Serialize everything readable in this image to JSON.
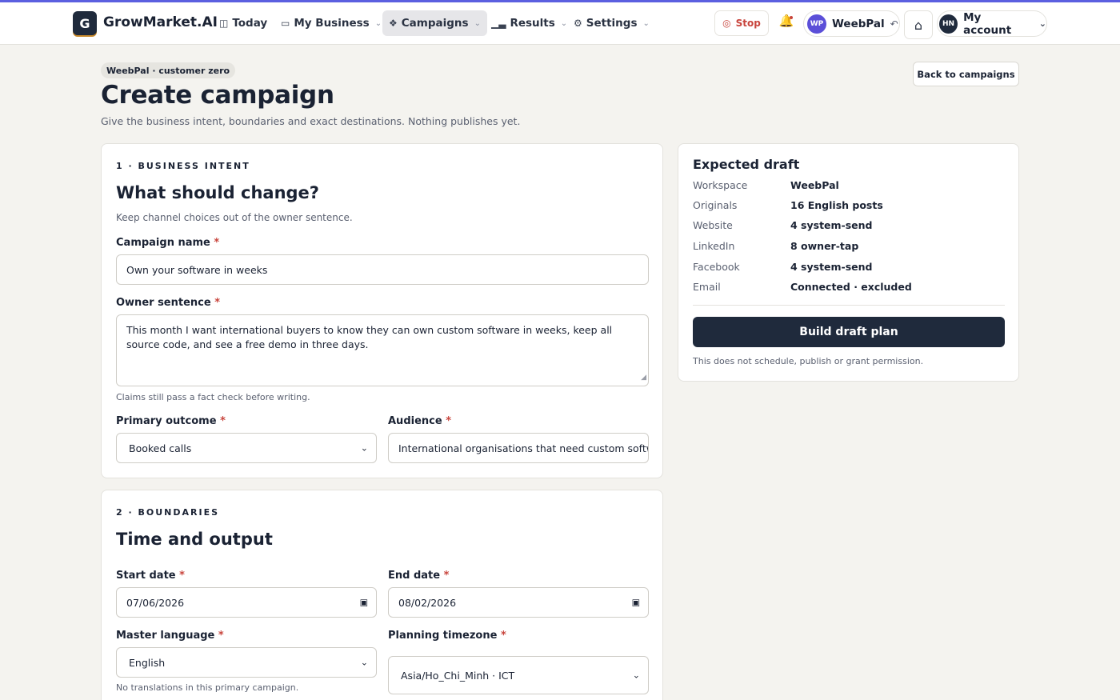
{
  "app": {
    "logo_letter": "G",
    "brand": "GrowMarket.AI"
  },
  "nav": {
    "items": [
      {
        "label": "Today",
        "icon": "inbox-icon",
        "chevron": false
      },
      {
        "label": "My Business",
        "icon": "book-icon",
        "chevron": true
      },
      {
        "label": "Campaigns",
        "icon": "layers-icon",
        "chevron": true,
        "active": true
      },
      {
        "label": "Results",
        "icon": "bar-chart-icon",
        "chevron": true
      },
      {
        "label": "Settings",
        "icon": "gear-icon",
        "chevron": true
      }
    ]
  },
  "header": {
    "stop_label": "Stop",
    "workspace_initials": "WP",
    "workspace_name": "WeebPal",
    "account_initials": "HN",
    "account_label": "My account"
  },
  "page": {
    "badge": "WeebPal · customer zero",
    "title": "Create campaign",
    "subtitle": "Give the business intent, boundaries and exact destinations. Nothing publishes yet.",
    "back_label": "Back to campaigns"
  },
  "section1": {
    "step": "1 · BUSINESS INTENT",
    "title": "What should change?",
    "hint": "Keep channel choices out of the owner sentence.",
    "campaign_name_label": "Campaign name",
    "campaign_name_value": "Own your software in weeks",
    "owner_sentence_label": "Owner sentence",
    "owner_sentence_value": "This month I want international buyers to know they can own custom software in weeks, keep all source code, and see a free demo in three days.",
    "owner_sentence_hint": "Claims still pass a fact check before writing.",
    "primary_outcome_label": "Primary outcome",
    "primary_outcome_value": "Booked calls",
    "audience_label": "Audience",
    "audience_value": "International organisations that need custom softw"
  },
  "section2": {
    "step": "2 · BOUNDARIES",
    "title": "Time and output",
    "start_date_label": "Start date",
    "start_date_value": "07/06/2026",
    "end_date_label": "End date",
    "end_date_value": "08/02/2026",
    "master_language_label": "Master language",
    "master_language_value": "English",
    "master_language_hint": "No translations in this primary campaign.",
    "timezone_label": "Planning timezone",
    "timezone_value": "Asia/Ho_Chi_Minh · ICT"
  },
  "required_mark": "*",
  "draft": {
    "title": "Expected draft",
    "rows": [
      {
        "key": "Workspace",
        "value": "WeebPal"
      },
      {
        "key": "Originals",
        "value": "16 English posts"
      },
      {
        "key": "Website",
        "value": "4 system-send"
      },
      {
        "key": "LinkedIn",
        "value": "8 owner-tap"
      },
      {
        "key": "Facebook",
        "value": "4 system-send"
      },
      {
        "key": "Email",
        "value": "Connected · excluded"
      }
    ],
    "build_label": "Build draft plan",
    "note": "This does not schedule, publish or grant permission."
  },
  "colors": {
    "accent": "#5b5fe0",
    "primary_dark": "#1f2a3c",
    "required": "#c8443c",
    "background": "#f4f3ef"
  }
}
